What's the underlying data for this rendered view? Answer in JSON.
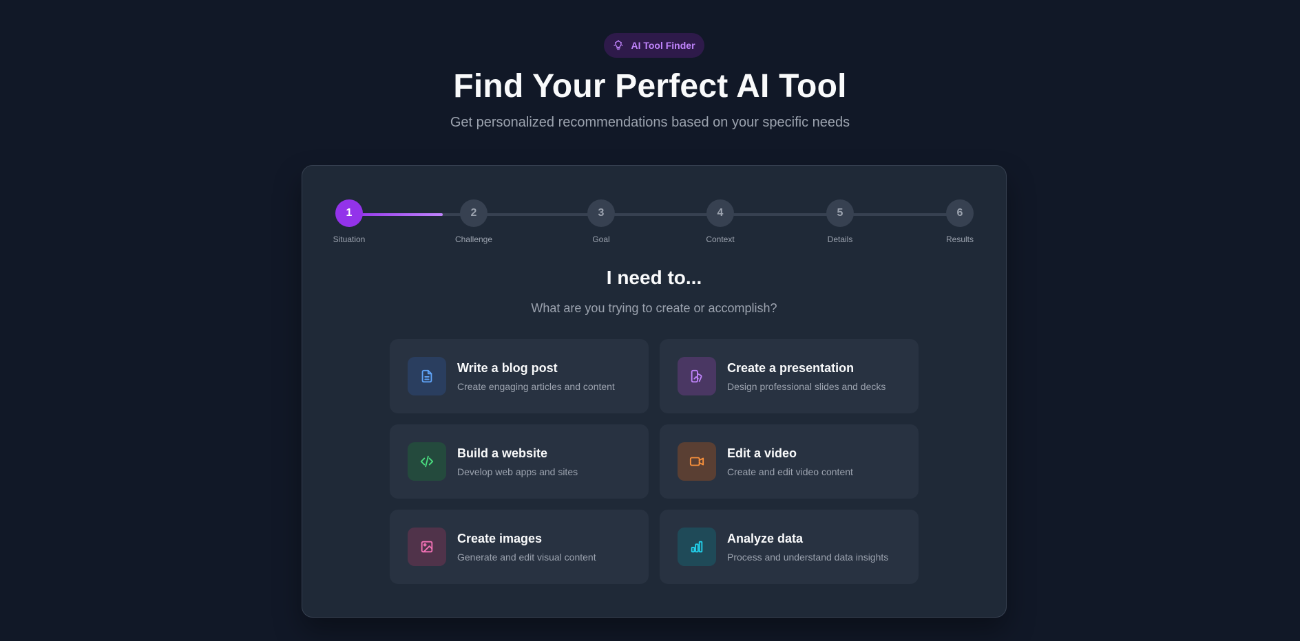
{
  "badge": {
    "label": "AI Tool Finder",
    "icon": "lightbulb-icon",
    "color": "#c084fc"
  },
  "header": {
    "title": "Find Your Perfect AI Tool",
    "subtitle": "Get personalized recommendations based on your specific needs"
  },
  "progress": {
    "current_step": 1,
    "fill_fraction_of_first_segment": 0.75,
    "accent": "#9333ea",
    "steps": [
      {
        "number": "1",
        "label": "Situation"
      },
      {
        "number": "2",
        "label": "Challenge"
      },
      {
        "number": "3",
        "label": "Goal"
      },
      {
        "number": "4",
        "label": "Context"
      },
      {
        "number": "5",
        "label": "Details"
      },
      {
        "number": "6",
        "label": "Results"
      }
    ]
  },
  "question": {
    "title": "I need to...",
    "subtitle": "What are you trying to create or accomplish?"
  },
  "options": [
    {
      "title": "Write a blog post",
      "description": "Create engaging articles and content",
      "icon": "document-icon",
      "color": "#60a5fa",
      "bg": "#2a3e5f"
    },
    {
      "title": "Create a presentation",
      "description": "Design professional slides and decks",
      "icon": "presentation-icon",
      "color": "#c084fc",
      "bg": "#4a3763"
    },
    {
      "title": "Build a website",
      "description": "Develop web apps and sites",
      "icon": "code-icon",
      "color": "#4ade80",
      "bg": "#244a3d"
    },
    {
      "title": "Edit a video",
      "description": "Create and edit video content",
      "icon": "video-camera-icon",
      "color": "#fb923c",
      "bg": "#5a3f33"
    },
    {
      "title": "Create images",
      "description": "Generate and edit visual content",
      "icon": "image-icon",
      "color": "#f472b6",
      "bg": "#50334a"
    },
    {
      "title": "Analyze data",
      "description": "Process and understand data insights",
      "icon": "bar-chart-icon",
      "color": "#22d3ee",
      "bg": "#1f4a58"
    }
  ]
}
